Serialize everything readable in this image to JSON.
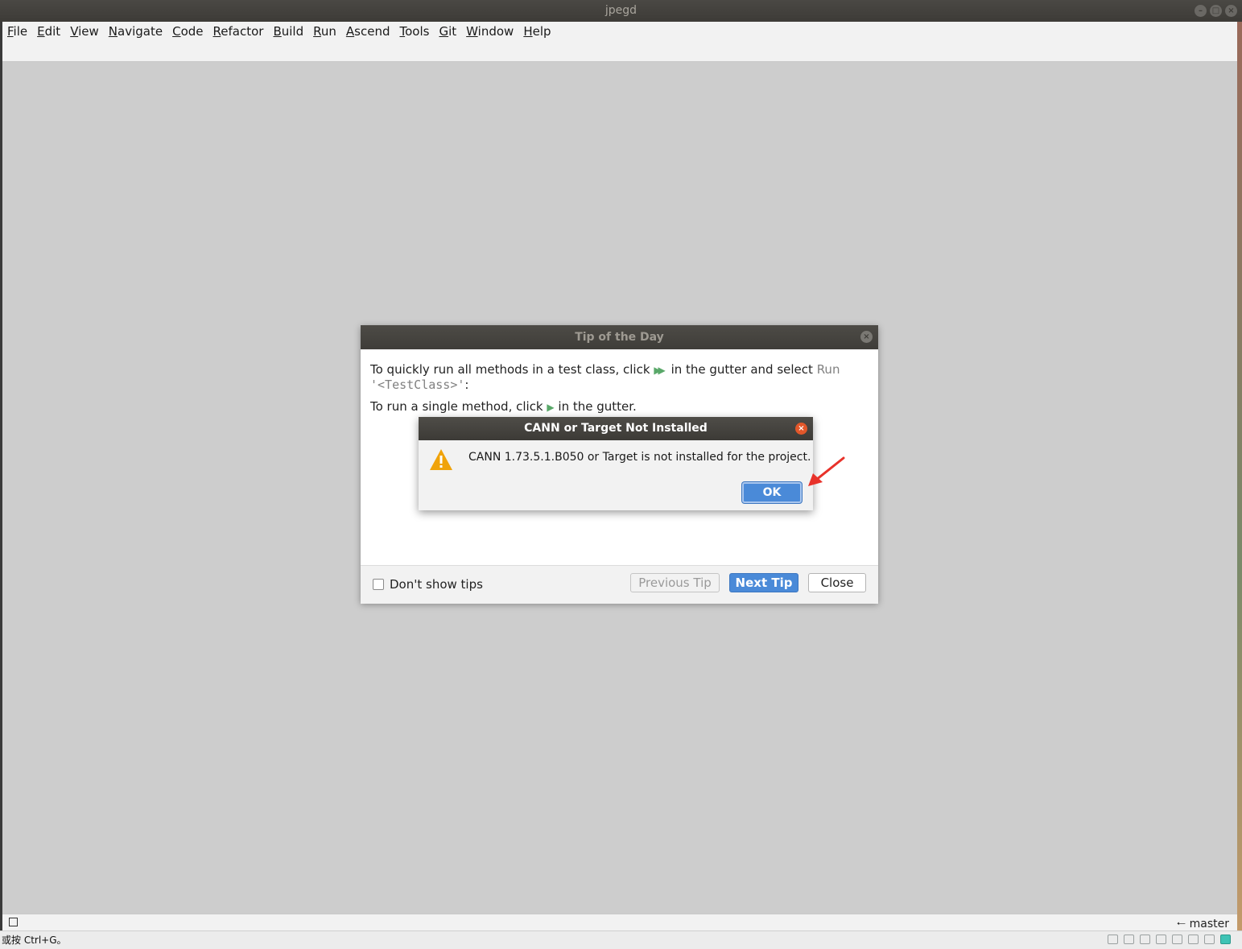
{
  "window": {
    "title": "jpegd",
    "controls": [
      "minimize-icon",
      "maximize-icon",
      "close-icon"
    ]
  },
  "menubar": {
    "items": [
      {
        "mnemonic": "F",
        "rest": "ile"
      },
      {
        "mnemonic": "E",
        "rest": "dit"
      },
      {
        "mnemonic": "V",
        "rest": "iew"
      },
      {
        "mnemonic": "N",
        "rest": "avigate"
      },
      {
        "mnemonic": "C",
        "rest": "ode"
      },
      {
        "mnemonic": "R",
        "rest": "efactor"
      },
      {
        "mnemonic": "B",
        "rest": "uild"
      },
      {
        "mnemonic": "R",
        "rest": "un"
      },
      {
        "mnemonic": "A",
        "rest": "scend"
      },
      {
        "mnemonic": "T",
        "rest": "ools"
      },
      {
        "mnemonic": "G",
        "rest": "it"
      },
      {
        "mnemonic": "W",
        "rest": "indow"
      },
      {
        "mnemonic": "H",
        "rest": "elp"
      }
    ]
  },
  "tip_dialog": {
    "title": "Tip of the Day",
    "line1_a": "To quickly run all methods in a test class, click",
    "line1_b": "in the gutter and select",
    "line1_run": "Run",
    "line1_class": "'<TestClass>'",
    "line1_end": ":",
    "line2_a": "To run a single method, click",
    "line2_b": "in the gutter.",
    "dont_show": "Don't show tips",
    "prev_btn": "Previous Tip",
    "next_btn": "Next Tip",
    "close_btn": "Close"
  },
  "alert": {
    "title": "CANN or Target Not Installed",
    "message": "CANN 1.73.5.1.B050 or Target is not installed for the project.",
    "ok": "OK",
    "icon": "warning-icon"
  },
  "ide_status": {
    "branch": "master"
  },
  "sys_bar": {
    "hint": "或按 Ctrl+G。"
  },
  "colors": {
    "accent": "#4a8ad8",
    "warning": "#f0a30a",
    "arrow": "#e8322a",
    "run_icon": "#59a869"
  }
}
